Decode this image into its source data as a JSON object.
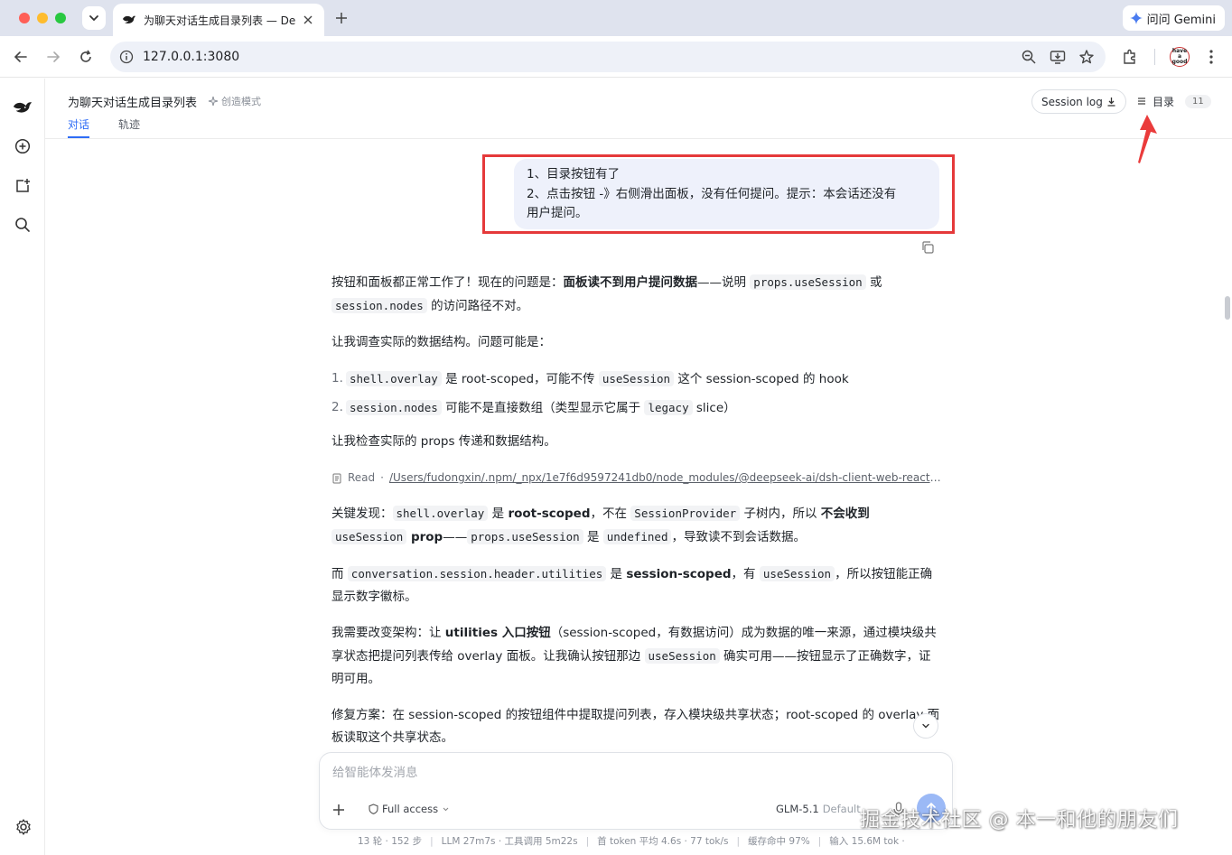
{
  "browser": {
    "tab_title": "为聊天对话生成目录列表 — De",
    "url": "127.0.0.1:3080",
    "gemini_label": "问问 Gemini",
    "profile_text": "have a good"
  },
  "header": {
    "title": "为聊天对话生成目录列表",
    "mode": "创造模式",
    "tabs": [
      {
        "label": "对话"
      },
      {
        "label": "轨迹"
      }
    ],
    "session_log": "Session log",
    "toc_label": "目录",
    "toc_count": "11"
  },
  "user_message": {
    "line1": "1、目录按钮有了",
    "line2": "2、点击按钮 -》右侧滑出面板，没有任何提问。提示：本会话还没有",
    "line3": "用户提问。"
  },
  "assistant": {
    "p1": {
      "t1": "按钮和面板都正常工作了！现在的问题是：",
      "b1": "面板读不到用户提问数据",
      "t2": "——说明 ",
      "c1": "props.useSession",
      "t3": " 或",
      "c2": "session.nodes",
      "t4": " 的访问路径不对。"
    },
    "p2": "让我调查实际的数据结构。问题可能是：",
    "list": [
      {
        "num": "1.",
        "c1": "shell.overlay",
        "t1": " 是 root-scoped，可能不传 ",
        "c2": "useSession",
        "t2": " 这个 session-scoped 的 hook"
      },
      {
        "num": "2.",
        "c1": "session.nodes",
        "t1": " 可能不是直接数组（类型显示它属于 ",
        "c2": "legacy",
        "t2": " slice）"
      }
    ],
    "p3": "让我检查实际的 props 传递和数据结构。",
    "read": {
      "label": "Read",
      "path": "/Users/fudongxin/.npm/_npx/1e7f6d9597241db0/node_modules/@deepseek-ai/dsh-client-web-react/li..."
    },
    "p4": {
      "t1": "关键发现：",
      "c1": "shell.overlay",
      "t2": " 是 ",
      "b1": "root-scoped",
      "t3": "，不在 ",
      "c2": "SessionProvider",
      "t4": " 子树内，所以 ",
      "b2": "不会收到",
      "c3": "useSession",
      "b3": " prop",
      "t5": "——",
      "c4": "props.useSession",
      "t6": " 是 ",
      "c5": "undefined",
      "t7": "，导致读不到会话数据。"
    },
    "p5": {
      "t1": "而 ",
      "c1": "conversation.session.header.utilities",
      "t2": " 是 ",
      "b1": "session-scoped",
      "t3": "，有 ",
      "c2": "useSession",
      "t4": "，所以按钮能正确显示数字徽标。"
    },
    "p6": {
      "t1": "我需要改变架构：让 ",
      "b1": "utilities 入口按钮",
      "t2": "（session-scoped，有数据访问）成为数据的唯一来源，通过模块级共享状态把提问列表传给 overlay 面板。让我确认按钮那边 ",
      "c1": "useSession",
      "t3": " 确实可用——按钮显示了正确数字，证明可用。"
    },
    "p7": "修复方案：在 session-scoped 的按钮组件中提取提问列表，存入模块级共享状态；root-scoped 的 overlay 面板读取这个共享状态。"
  },
  "composer": {
    "placeholder": "给智能体发消息",
    "access": "Full access",
    "model": "GLM-5.1",
    "model_default": "Default"
  },
  "stats": [
    "13 轮 · 152 步",
    "LLM 27m7s · 工具调用 5m22s",
    "首 token 平均 4.6s · 77 tok/s",
    "缓存命中 97%",
    "输入 15.6M tok ·"
  ],
  "watermark": "掘金技术社区 @ 本一和他的朋友们",
  "colors": {
    "accent": "#2f6df6",
    "highlight": "#e5393a",
    "bubble": "#eef1fb"
  }
}
